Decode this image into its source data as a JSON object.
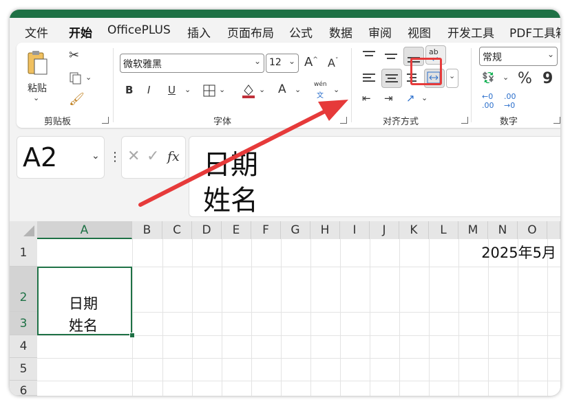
{
  "tabs": [
    "文件",
    "开始",
    "OfficePLUS",
    "插入",
    "页面布局",
    "公式",
    "数据",
    "审阅",
    "视图",
    "开发工具",
    "PDF工具箱"
  ],
  "active_tab": "开始",
  "ribbon": {
    "clipboard": {
      "paste_label": "粘贴",
      "group_label": "剪贴板"
    },
    "font": {
      "font_name": "微软雅黑",
      "font_size": "12",
      "bold": "B",
      "italic": "I",
      "underline": "U",
      "phonetic_top": "wén",
      "phonetic_bottom": "文",
      "group_label": "字体"
    },
    "alignment": {
      "group_label": "对齐方式",
      "wrap_text_glyph": "ab"
    },
    "number": {
      "format": "常规",
      "percent": "%",
      "comma": "9",
      "group_label": "数字"
    }
  },
  "formula_bar": {
    "name_box": "A2",
    "fx": "fx",
    "content_line1": "日期",
    "content_line2": "姓名"
  },
  "grid": {
    "columns": [
      "A",
      "B",
      "C",
      "D",
      "E",
      "F",
      "G",
      "H",
      "I",
      "J",
      "K",
      "L",
      "M",
      "N",
      "O"
    ],
    "rows": [
      "1",
      "2",
      "3",
      "4",
      "5",
      "6"
    ],
    "cell_e1": "2025年5月",
    "cell_a2_line1": "日期",
    "cell_a2_line2": "姓名"
  },
  "colors": {
    "accent": "#1e7145",
    "annotation": "#e63a3a"
  }
}
